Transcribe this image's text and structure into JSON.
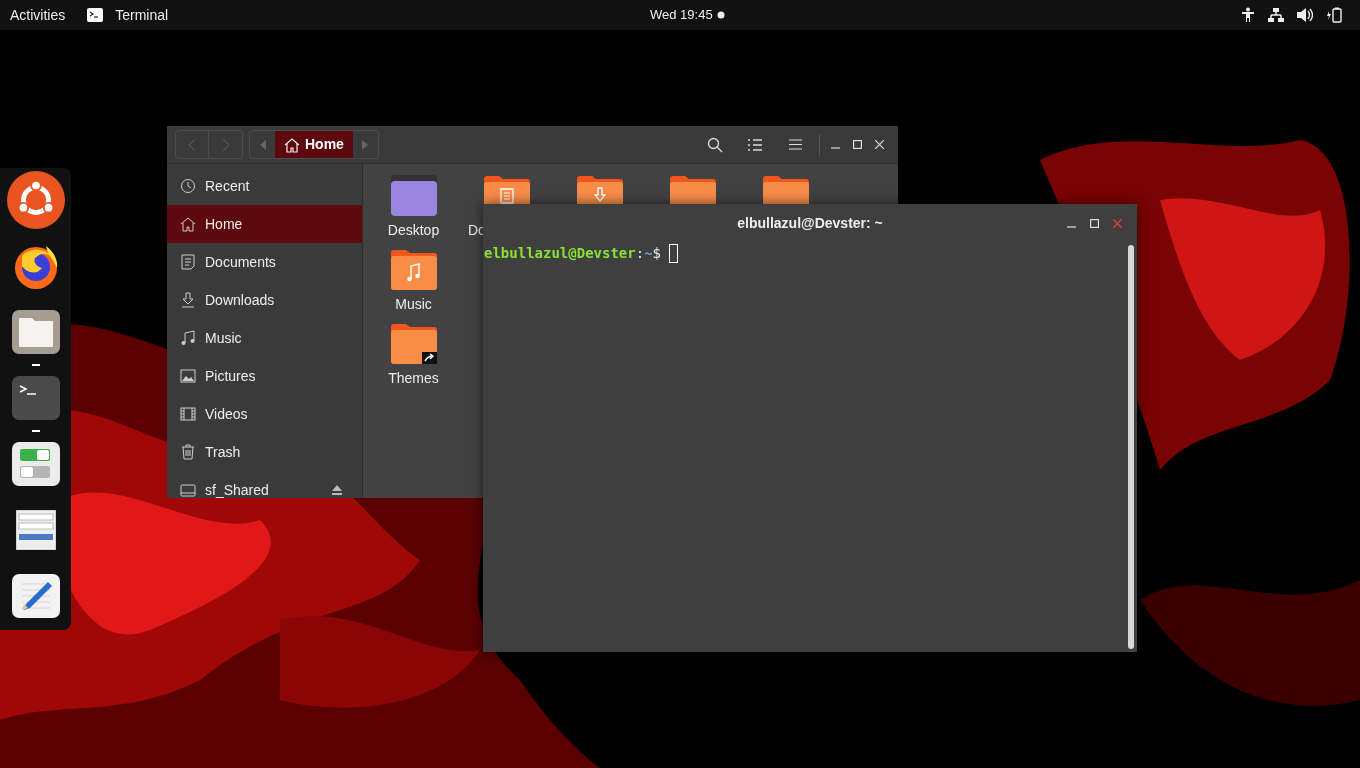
{
  "top_bar": {
    "activities": "Activities",
    "app_name": "Terminal",
    "clock": "Wed 19:45",
    "notification": true
  },
  "dock": {
    "apps": [
      {
        "kind": "ubuntu",
        "running": false
      },
      {
        "kind": "firefox",
        "running": false
      },
      {
        "kind": "files",
        "running": true
      },
      {
        "kind": "terminal",
        "running": true
      },
      {
        "kind": "settings",
        "running": false
      },
      {
        "kind": "forms",
        "running": false
      },
      {
        "kind": "editor",
        "running": false
      }
    ]
  },
  "files": {
    "path": "Home",
    "sidebar": [
      {
        "kind": "recent",
        "label": "Recent",
        "selected": false
      },
      {
        "kind": "home",
        "label": "Home",
        "selected": true
      },
      {
        "kind": "documents",
        "label": "Documents",
        "selected": false
      },
      {
        "kind": "downloads",
        "label": "Downloads",
        "selected": false
      },
      {
        "kind": "music",
        "label": "Music",
        "selected": false
      },
      {
        "kind": "pictures",
        "label": "Pictures",
        "selected": false
      },
      {
        "kind": "videos",
        "label": "Videos",
        "selected": false
      },
      {
        "kind": "trash",
        "label": "Trash",
        "selected": false
      },
      {
        "kind": "drive",
        "label": "sf_Shared",
        "selected": false
      }
    ],
    "rows": [
      [
        {
          "kind": "desktop",
          "label": "Desktop"
        },
        {
          "kind": "documents",
          "label": "Do",
          "cut": true
        },
        {
          "kind": "downloads"
        },
        {
          "kind": "folder"
        },
        {
          "kind": "folder"
        }
      ],
      [
        {
          "kind": "music",
          "label": "Music"
        }
      ],
      [
        {
          "kind": "link",
          "label": "Themes"
        }
      ]
    ]
  },
  "terminal": {
    "title": "elbullazul@Devster: ~",
    "user_host": "elbullazul@Devster",
    "separator": ":",
    "path": "~",
    "prompt_symbol": "$"
  }
}
